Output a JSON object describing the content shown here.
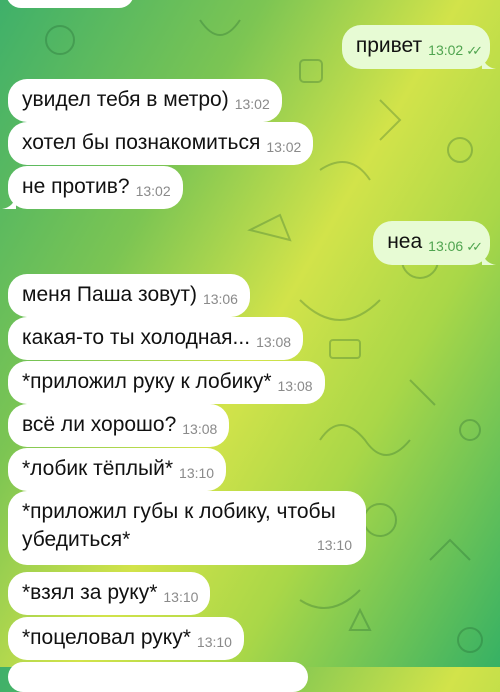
{
  "messages": [
    {
      "text": "привет",
      "time": "13:02",
      "dir": "out",
      "read": true
    },
    {
      "text": "увидел тебя в метро)",
      "time": "13:02",
      "dir": "in"
    },
    {
      "text": "хотел бы познакомиться",
      "time": "13:02",
      "dir": "in"
    },
    {
      "text": "не против?",
      "time": "13:02",
      "dir": "in"
    },
    {
      "text": "неа",
      "time": "13:06",
      "dir": "out",
      "read": true
    },
    {
      "text": "меня Паша зовут)",
      "time": "13:06",
      "dir": "in"
    },
    {
      "text": "какая-то ты холодная...",
      "time": "13:08",
      "dir": "in"
    },
    {
      "text": "*приложил руку к лобику*",
      "time": "13:08",
      "dir": "in"
    },
    {
      "text": "всё  ли хорошо?",
      "time": "13:08",
      "dir": "in"
    },
    {
      "text": "*лобик тёплый*",
      "time": "13:10",
      "dir": "in"
    },
    {
      "text": "*приложил губы к лобику, чтобы убедиться*",
      "line1": "*приложил губы к лобику, чтобы",
      "line2": "убедиться*",
      "time": "13:10",
      "dir": "in"
    },
    {
      "text": "*взял за руку*",
      "time": "13:10",
      "dir": "in"
    },
    {
      "text": "*поцеловал руку*",
      "time": "13:10",
      "dir": "in"
    }
  ],
  "read_indicator_icon": "double-check-icon",
  "colors": {
    "incoming": "#ffffff",
    "outgoing": "#e7fbd4",
    "check": "#4fa44f",
    "timestamp": "#8a8a8a"
  }
}
